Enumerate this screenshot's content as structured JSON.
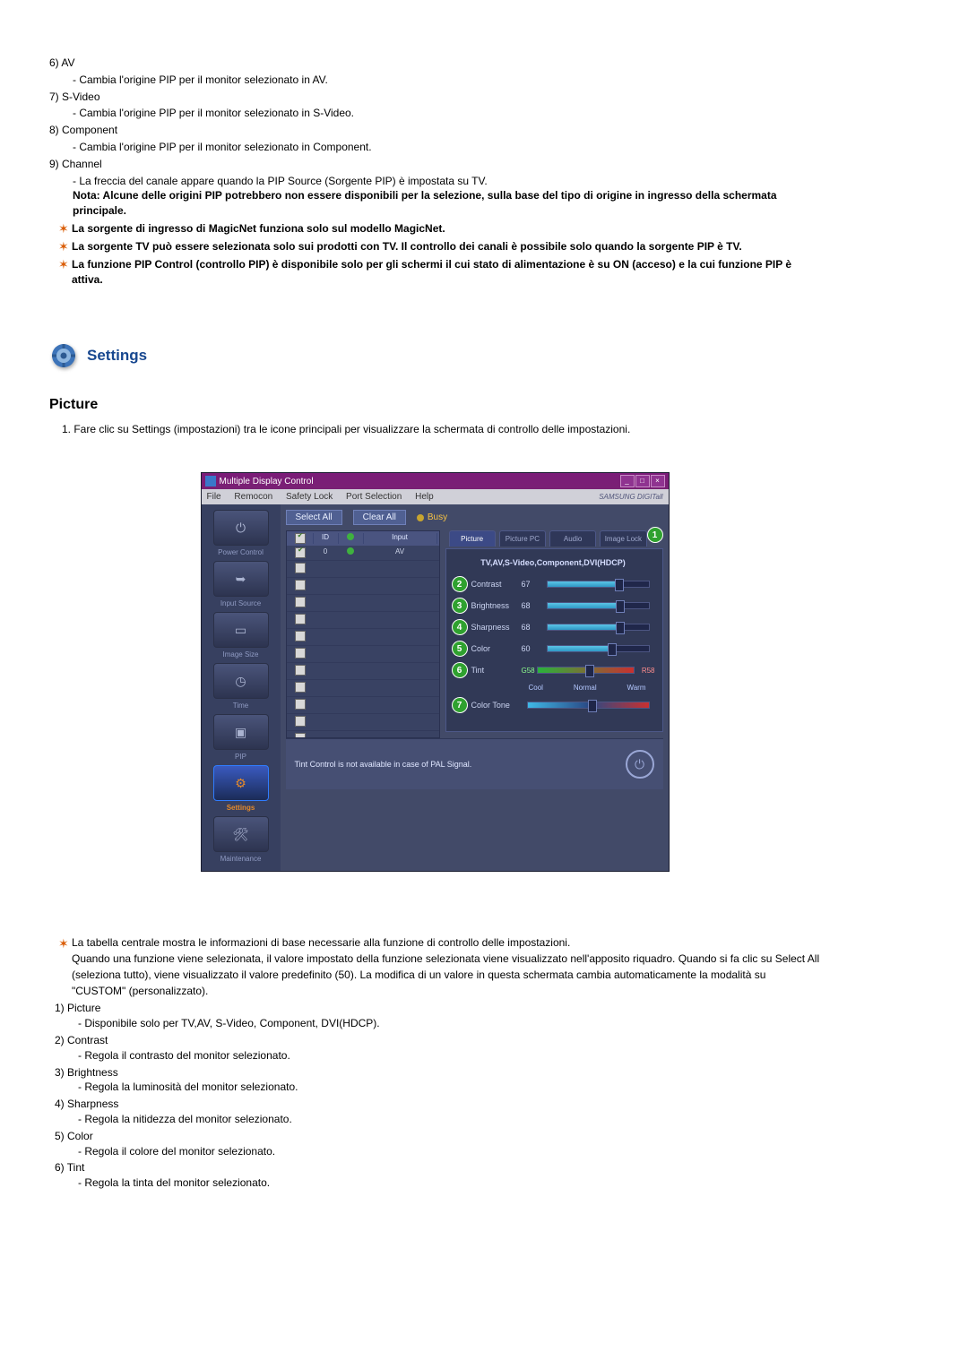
{
  "top_list": {
    "6": {
      "label": "AV",
      "desc": "- Cambia l'origine PIP per il monitor selezionato in AV."
    },
    "7": {
      "label": "S-Video",
      "desc": "- Cambia l'origine PIP per il monitor selezionato in S-Video."
    },
    "8": {
      "label": "Component",
      "desc": "- Cambia l'origine PIP per il monitor selezionato in Component."
    },
    "9": {
      "label": "Channel",
      "desc": "- La freccia del canale appare quando la PIP Source (Sorgente PIP) è impostata su TV."
    }
  },
  "note_text": "Nota: Alcune delle origini PIP potrebbero non essere disponibili per la selezione, sulla base del tipo di origine in ingresso della schermata principale.",
  "star_notes": [
    "La sorgente di ingresso di MagicNet funziona solo sul modello MagicNet.",
    "La sorgente TV può essere selezionata solo sui prodotti con TV. Il controllo dei canali è possibile solo quando la sorgente PIP è TV.",
    "La funzione PIP Control (controllo PIP) è disponibile solo per gli schermi il cui stato di alimentazione è su ON (acceso) e la cui funzione PIP è attiva."
  ],
  "settings_title": "Settings",
  "picture_title": "Picture",
  "intro_line": "1. Fare clic su Settings (impostazioni) tra le icone principali per visualizzare la schermata di controllo delle impostazioni.",
  "window": {
    "title": "Multiple Display Control",
    "menus": [
      "File",
      "Remocon",
      "Safety Lock",
      "Port Selection",
      "Help"
    ],
    "brand": "SAMSUNG DIGITall",
    "select_all": "Select All",
    "clear_all": "Clear All",
    "busy": "Busy",
    "sidebar": {
      "power": "Power Control",
      "input": "Input Source",
      "image": "Image Size",
      "time": "Time",
      "pip": "PIP",
      "settings": "Settings",
      "maint": "Maintenance"
    },
    "tabs": {
      "picture": "Picture",
      "picturepc": "Picture PC",
      "audio": "Audio",
      "imagelock": "Image Lock"
    },
    "table_head": {
      "c1": "",
      "c2": "ID",
      "c3": "",
      "c4": "Input"
    },
    "row1": {
      "c2": "0",
      "c4": "AV"
    },
    "header_line": "TV,AV,S-Video,Component,DVI(HDCP)",
    "controls": {
      "contrast": {
        "label": "Contrast",
        "val": "67"
      },
      "brightness": {
        "label": "Brightness",
        "val": "68"
      },
      "sharpness": {
        "label": "Sharpness",
        "val": "68"
      },
      "color": {
        "label": "Color",
        "val": "60"
      },
      "tint": {
        "label": "Tint",
        "valG": "G58",
        "valR": "R58"
      },
      "colortone": {
        "label": "Color Tone",
        "cool": "Cool",
        "normal": "Normal",
        "warm": "Warm"
      }
    },
    "footer_text": "Tint Control is not available in case of PAL Signal."
  },
  "bottom_star": "La tabella centrale mostra le informazioni di base necessarie alla funzione di controllo delle impostazioni.",
  "bottom_para": "Quando una funzione viene selezionata, il valore impostato della funzione selezionata viene visualizzato nell'apposito riquadro. Quando si fa clic su Select All (seleziona tutto), viene visualizzato il valore predefinito (50). La modifica di un valore in questa schermata cambia automaticamente la modalità su \"CUSTOM\" (personalizzato).",
  "bottom_list": {
    "1": {
      "label": "Picture",
      "desc": "- Disponibile solo per TV,AV, S-Video, Component, DVI(HDCP)."
    },
    "2": {
      "label": "Contrast",
      "desc": "- Regola il contrasto del monitor selezionato."
    },
    "3": {
      "label": "Brightness",
      "desc": "- Regola la luminosità del monitor selezionato."
    },
    "4": {
      "label": "Sharpness",
      "desc": "- Regola la nitidezza del monitor selezionato."
    },
    "5": {
      "label": "Color",
      "desc": "- Regola il colore del monitor selezionato."
    },
    "6": {
      "label": "Tint",
      "desc": "- Regola la tinta del monitor selezionato."
    }
  }
}
